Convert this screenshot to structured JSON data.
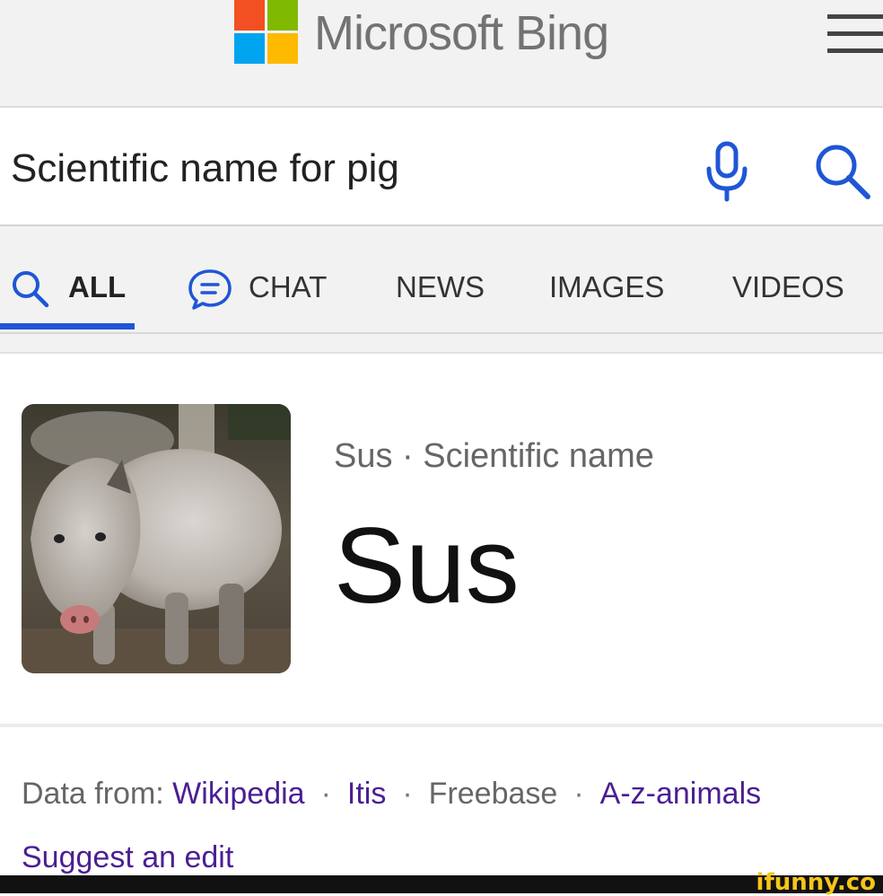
{
  "header": {
    "brand": "Microsoft Bing",
    "logo_colors": [
      "#f25022",
      "#7fba00",
      "#00a4ef",
      "#ffb900"
    ],
    "menu_icon": "hamburger-menu-icon"
  },
  "search": {
    "query": "Scientific name for pig",
    "mic_icon": "microphone-icon",
    "search_icon": "search-icon",
    "accent": "#1f56d6"
  },
  "tabs": [
    {
      "label": "ALL",
      "icon": "search-icon",
      "active": true
    },
    {
      "label": "CHAT",
      "icon": "chat-bubble-icon",
      "active": false
    },
    {
      "label": "NEWS",
      "active": false
    },
    {
      "label": "IMAGES",
      "active": false
    },
    {
      "label": "VIDEOS",
      "active": false
    }
  ],
  "result": {
    "subtitle": "Sus · Scientific name",
    "answer": "Sus",
    "image_alt": "pig photo"
  },
  "sources": {
    "prefix": "Data from:",
    "items": [
      {
        "label": "Wikipedia",
        "link": true
      },
      {
        "label": "Itis",
        "link": true
      },
      {
        "label": "Freebase",
        "link": false
      },
      {
        "label": "A-z-animals",
        "link": true
      }
    ],
    "suggest": "Suggest an edit",
    "link_color": "#4b1f93"
  },
  "watermark": "ifunny.co"
}
